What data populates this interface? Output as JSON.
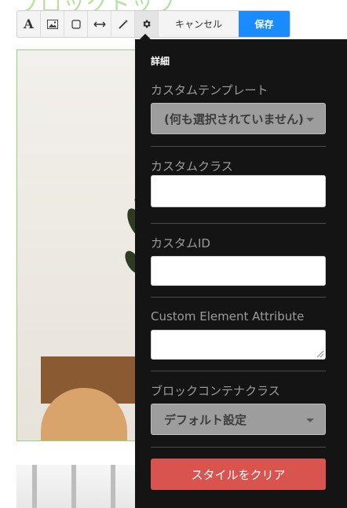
{
  "background": {
    "heading_text": "ブロックトップ"
  },
  "toolbar": {
    "tools": [
      {
        "icon": "text-format-icon",
        "glyph": "A"
      },
      {
        "icon": "image-icon"
      },
      {
        "icon": "border-box-icon"
      },
      {
        "icon": "spacing-arrows-icon"
      },
      {
        "icon": "magic-wand-icon"
      },
      {
        "icon": "gear-icon"
      }
    ],
    "cancel_label": "キャンセル",
    "save_label": "保存",
    "save_color": "#1a8cff"
  },
  "panel": {
    "title": "詳細",
    "custom_template": {
      "label": "カスタムテンプレート",
      "value": "(何も選択されていません)"
    },
    "custom_class": {
      "label": "カスタムクラス",
      "value": ""
    },
    "custom_id": {
      "label": "カスタムID",
      "value": ""
    },
    "custom_attribute": {
      "label": "Custom Element Attribute",
      "value": ""
    },
    "block_container_class": {
      "label": "ブロックコンテナクラス",
      "value": "デフォルト設定"
    },
    "clear_styles_label": "スタイルをクリア",
    "clear_color": "#d9534f"
  }
}
